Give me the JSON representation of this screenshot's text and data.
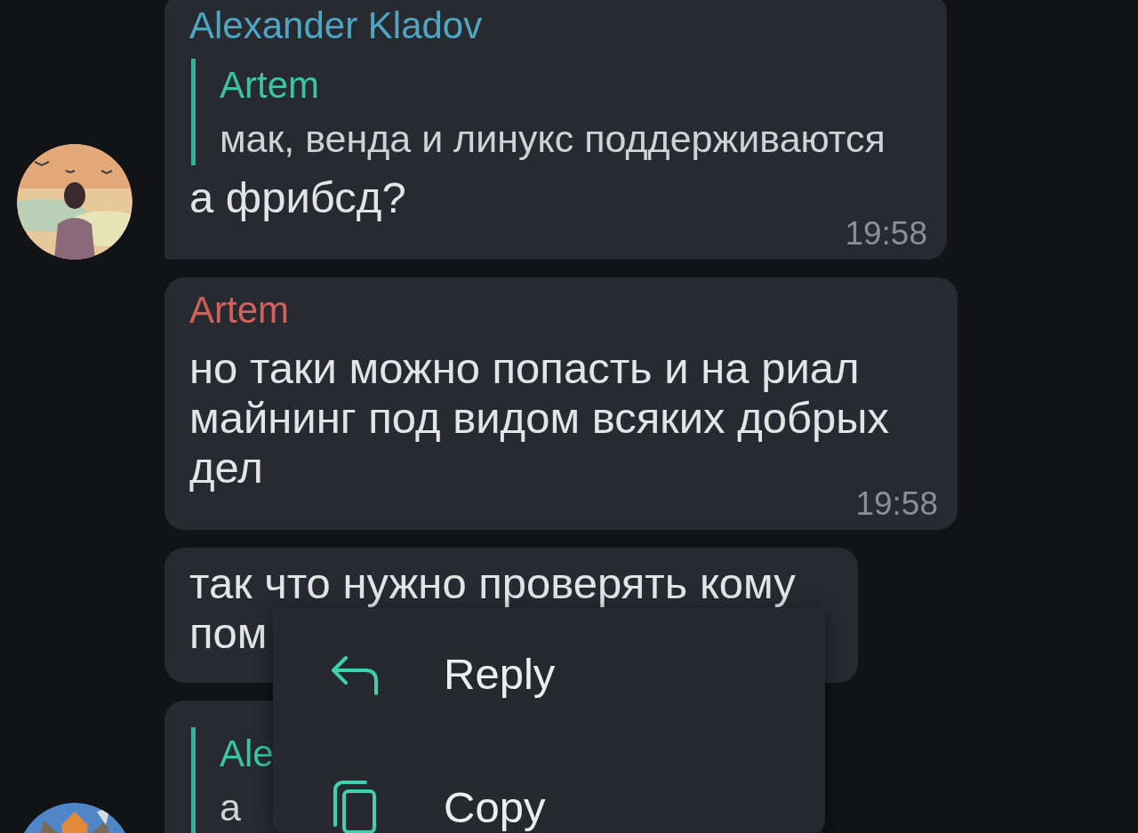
{
  "messages": [
    {
      "sender": "Alexander Kladov",
      "color": "#4fa6c2",
      "quote": {
        "name": "Artem",
        "text": "мак, венда и линукс поддерживаются"
      },
      "text": "а фрибсд?",
      "time": "19:58"
    },
    {
      "sender": "Artem",
      "color": "#d3605b",
      "text": "но таки можно попасть и на риал майнинг под видом всяких добрых дел",
      "time": "19:58"
    },
    {
      "text": "так что нужно проверять кому пом"
    },
    {
      "quote": {
        "name": "Ale",
        "text": "а"
      }
    }
  ],
  "context_menu": {
    "items": [
      {
        "kind": "reply",
        "label": "Reply"
      },
      {
        "kind": "copy",
        "label": "Copy"
      }
    ]
  }
}
